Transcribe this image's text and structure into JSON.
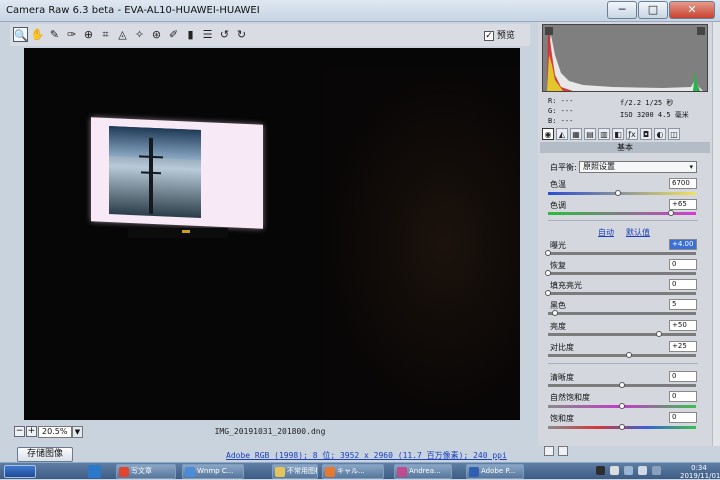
{
  "window": {
    "title": "Camera Raw 6.3 beta -  EVA-AL10-HUAWEI-HUAWEI",
    "min_glyph": "─",
    "max_glyph": "□",
    "close_glyph": "✕"
  },
  "toolbar": {
    "tools": [
      {
        "icon": "zoom-icon",
        "glyph": "🔍"
      },
      {
        "icon": "hand-icon",
        "glyph": "✋"
      },
      {
        "icon": "white-balance-eyedropper-icon",
        "glyph": "✎"
      },
      {
        "icon": "color-sampler-icon",
        "glyph": "✑"
      },
      {
        "icon": "targeted-adjustment-icon",
        "glyph": "⊕"
      },
      {
        "icon": "crop-icon",
        "glyph": "⌗"
      },
      {
        "icon": "straighten-icon",
        "glyph": "◬"
      },
      {
        "icon": "spot-removal-icon",
        "glyph": "✧"
      },
      {
        "icon": "red-eye-icon",
        "glyph": "⊛"
      },
      {
        "icon": "adjustment-brush-icon",
        "glyph": "✐"
      },
      {
        "icon": "graduated-filter-icon",
        "glyph": "▮"
      },
      {
        "icon": "preferences-icon",
        "glyph": "☰"
      },
      {
        "icon": "rotate-left-icon",
        "glyph": "↺"
      },
      {
        "icon": "rotate-right-icon",
        "glyph": "↻"
      }
    ],
    "preview_label": "预览",
    "preview_checked": true,
    "preview_check_glyph": "✓"
  },
  "image_bar": {
    "zoom_out": "−",
    "zoom_in": "+",
    "zoom_value": "20.5%",
    "zoom_drop": "▼",
    "filename": "IMG_20191031_201800.dng"
  },
  "footer": {
    "save_label": "存储图像",
    "workflow_link": "Adobe RGB (1998); 8 位; 3952 x 2960 (11.7 百万像素); 240 ppi"
  },
  "readout": {
    "r": "R:  ---",
    "g": "G:  ---",
    "b": "B:  ---",
    "meta1": "f/2.2  1/25 秒",
    "meta2": "ISO 3200  4.5 毫米"
  },
  "panel": {
    "title": "基本",
    "wb_label": "白平衡:",
    "wb_value": "原照设置",
    "wb_arrow": "▾",
    "auto_link": "自动",
    "default_link": "默认值",
    "tab_glyphs": [
      "◉",
      "◭",
      "▦",
      "▤",
      "▥",
      "◧",
      "ƒx",
      "◘",
      "◐",
      "◫"
    ],
    "sliders": [
      {
        "name": "temperature",
        "label": "色温",
        "value": "6700",
        "pos": 0.47,
        "track": "linear-gradient(90deg,#2a4bd6,#f2e25a)"
      },
      {
        "name": "tint",
        "label": "色调",
        "value": "+65",
        "pos": 0.83,
        "track": "linear-gradient(90deg,#2bbd3a,#d43bd0)"
      },
      {
        "name": "exposure",
        "label": "曝光",
        "value": "+4.00",
        "pos": 0.0,
        "track": "#7c7c7c",
        "selected": true
      },
      {
        "name": "recovery",
        "label": "恢复",
        "value": "0",
        "pos": 0.0,
        "track": "#7c7c7c"
      },
      {
        "name": "fill-light",
        "label": "填充亮光",
        "value": "0",
        "pos": 0.0,
        "track": "#7c7c7c"
      },
      {
        "name": "blacks",
        "label": "黑色",
        "value": "5",
        "pos": 0.05,
        "track": "#7c7c7c"
      },
      {
        "name": "brightness",
        "label": "亮度",
        "value": "+50",
        "pos": 0.75,
        "track": "#7c7c7c"
      },
      {
        "name": "contrast",
        "label": "对比度",
        "value": "+25",
        "pos": 0.55,
        "track": "#7c7c7c"
      },
      {
        "name": "clarity",
        "label": "清晰度",
        "value": "0",
        "pos": 0.5,
        "track": "#7c7c7c"
      },
      {
        "name": "vibrance",
        "label": "自然饱和度",
        "value": "0",
        "pos": 0.5,
        "track": "linear-gradient(90deg,#8a8a8a,#c23bc8,#3bc04d)"
      },
      {
        "name": "saturation",
        "label": "饱和度",
        "value": "0",
        "pos": 0.5,
        "track": "linear-gradient(90deg,#8a8a8a,#d13a3a,#3b5fd1,#3bc04d)"
      }
    ]
  },
  "taskbar": {
    "apps": [
      {
        "name": "browser",
        "label": "写文章",
        "color": "#e0462f"
      },
      {
        "name": "wnmp",
        "label": "Wnmp C...",
        "color": "#4b8cd8"
      },
      {
        "name": "folder",
        "label": "不常用图标",
        "color": "#e4c35a"
      },
      {
        "name": "firefox",
        "label": "キャル...",
        "color": "#e8782c"
      },
      {
        "name": "andrea",
        "label": "Andrea...",
        "color": "#c04b8d"
      },
      {
        "name": "photoshop",
        "label": "Adobe P...",
        "color": "#2e5fb0"
      }
    ],
    "clock_time": "0:34",
    "clock_date": "2019/11/01"
  }
}
